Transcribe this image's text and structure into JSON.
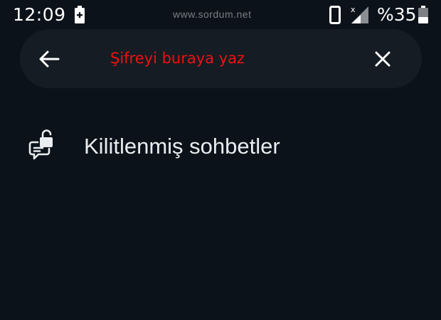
{
  "status_bar": {
    "time": "12:09",
    "watermark": "www.sordum.net",
    "battery_percent": "%35",
    "signal_badge": "x",
    "icons": [
      "charging-battery-icon",
      "phone-icon",
      "signal-icon",
      "battery-icon"
    ]
  },
  "search": {
    "placeholder": "Şifreyi buraya yaz",
    "value": "",
    "back_icon": "arrow-left-icon",
    "clear_icon": "close-icon"
  },
  "results": {
    "items": [
      {
        "label": "Kilitlenmiş sohbetler",
        "icon": "chat-lock-icon"
      }
    ]
  },
  "colors": {
    "background": "#0c121a",
    "search_bar": "#151c23",
    "placeholder_text": "#ee1111",
    "primary_text": "#e9edef",
    "watermark_text": "#7b7f84"
  }
}
